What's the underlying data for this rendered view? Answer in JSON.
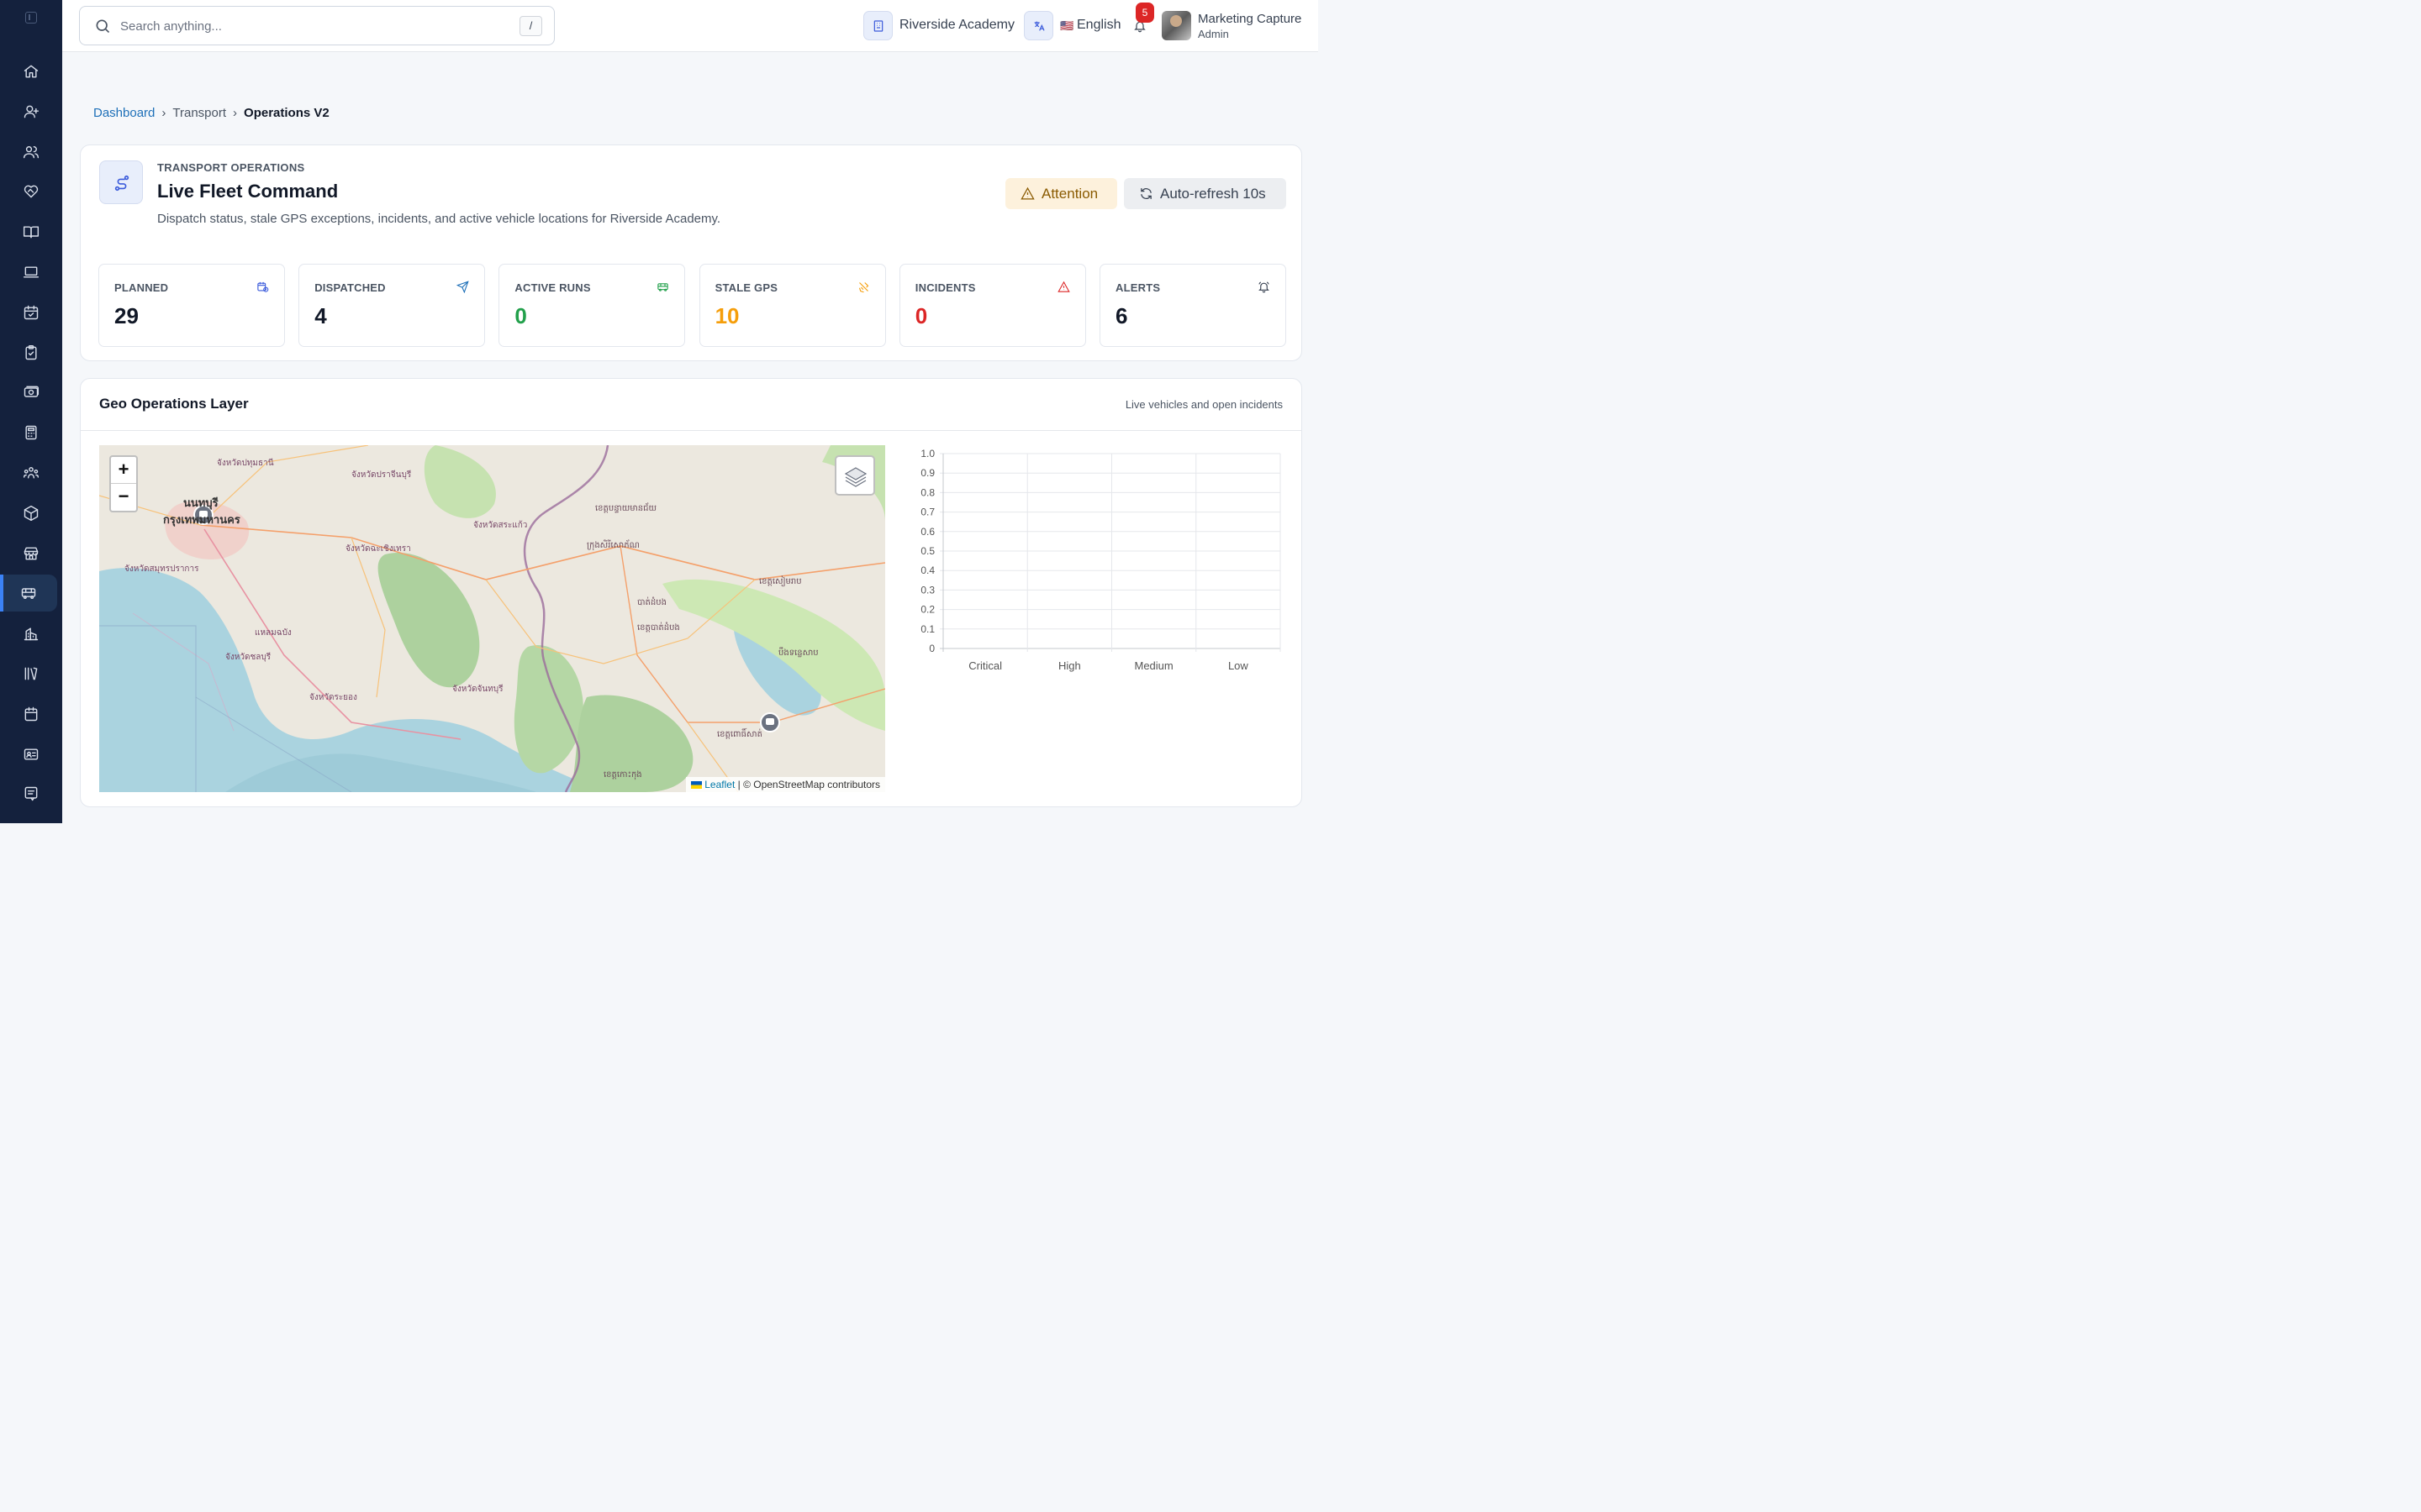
{
  "sidebar": {
    "items": [
      {
        "icon": "home-icon"
      },
      {
        "icon": "user-plus-icon"
      },
      {
        "icon": "users-icon"
      },
      {
        "icon": "heart-handshake-icon"
      },
      {
        "icon": "book-open-icon"
      },
      {
        "icon": "laptop-icon"
      },
      {
        "icon": "calendar-check-icon"
      },
      {
        "icon": "clipboard-check-icon"
      },
      {
        "icon": "money-icon"
      },
      {
        "icon": "calculator-icon"
      },
      {
        "icon": "group-icon"
      },
      {
        "icon": "package-icon"
      },
      {
        "icon": "store-icon"
      },
      {
        "icon": "bus-icon",
        "active": true
      },
      {
        "icon": "building-icon"
      },
      {
        "icon": "library-icon"
      },
      {
        "icon": "calendar-icon"
      },
      {
        "icon": "id-card-icon"
      },
      {
        "icon": "receipt-icon"
      }
    ]
  },
  "topbar": {
    "search_placeholder": "Search anything...",
    "search_shortcut": "/",
    "school": "Riverside Academy",
    "language_flag": "🇺🇸",
    "language": "English",
    "notifications_count": "5",
    "user_name": "Marketing Capture",
    "user_role": "Admin"
  },
  "breadcrumb": {
    "home": "Dashboard",
    "section": "Transport",
    "current": "Operations V2",
    "separator": "›"
  },
  "hero": {
    "eyebrow": "TRANSPORT OPERATIONS",
    "title": "Live Fleet Command",
    "description": "Dispatch status, stale GPS exceptions, incidents, and active vehicle locations for Riverside Academy.",
    "status_label": "Attention",
    "refresh_label": "Auto-refresh 10s"
  },
  "stats": [
    {
      "label": "PLANNED",
      "value": "29",
      "color": "#111827",
      "icon": "calendar-clock-icon",
      "icon_color": "#3b5bdb"
    },
    {
      "label": "DISPATCHED",
      "value": "4",
      "color": "#111827",
      "icon": "send-icon",
      "icon_color": "#1d6fb8"
    },
    {
      "label": "ACTIVE RUNS",
      "value": "0",
      "color": "#22a04b",
      "icon": "bus-icon",
      "icon_color": "#22a04b"
    },
    {
      "label": "STALE GPS",
      "value": "10",
      "color": "#f59e0b",
      "icon": "satellite-off-icon",
      "icon_color": "#f59e0b"
    },
    {
      "label": "INCIDENTS",
      "value": "0",
      "color": "#dc2626",
      "icon": "alert-triangle-icon",
      "icon_color": "#dc2626"
    },
    {
      "label": "ALERTS",
      "value": "6",
      "color": "#111827",
      "icon": "bell-ring-icon",
      "icon_color": "#374151"
    }
  ],
  "geo": {
    "title": "Geo Operations Layer",
    "subtitle": "Live vehicles and open incidents",
    "map": {
      "zoom_in": "+",
      "zoom_out": "−",
      "attribution_link": "Leaflet",
      "attribution_text": "| © OpenStreetMap contributors",
      "labels": [
        "จังหวัดปทุมธานี",
        "นนทบุรี",
        "กรุงเทพมหานคร",
        "จังหวัดปราจีนบุรี",
        "จังหวัดสระแก้ว",
        "ខេត្តបន្ទាយមានជ័យ",
        "ក្រុងសិរីសោភ័ណ",
        "จังหวัดฉะเชิงเทรา",
        "จังหวัดสมุทรปราการ",
        "จังหวัดชลบุรี",
        "แหลมฉบัง",
        "จังหวัดระยอง",
        "จังหวัดจันทบุรี",
        "ខេត្តបាត់ដំបង",
        "ខេត្តសៀមរាប",
        "ខេត្តពោធិ៍សាត់",
        "ខេត្តកោះកុង",
        "បាត់ដំបង",
        "បឹងទន្លេសាប"
      ]
    }
  },
  "chart_data": {
    "type": "bar",
    "categories": [
      "Critical",
      "High",
      "Medium",
      "Low"
    ],
    "values": [
      0,
      0,
      0,
      0
    ],
    "ylim": [
      0,
      1.0
    ],
    "yticks": [
      "0",
      "0.1",
      "0.2",
      "0.3",
      "0.4",
      "0.5",
      "0.6",
      "0.7",
      "0.8",
      "0.9",
      "1.0"
    ],
    "grid": true
  }
}
